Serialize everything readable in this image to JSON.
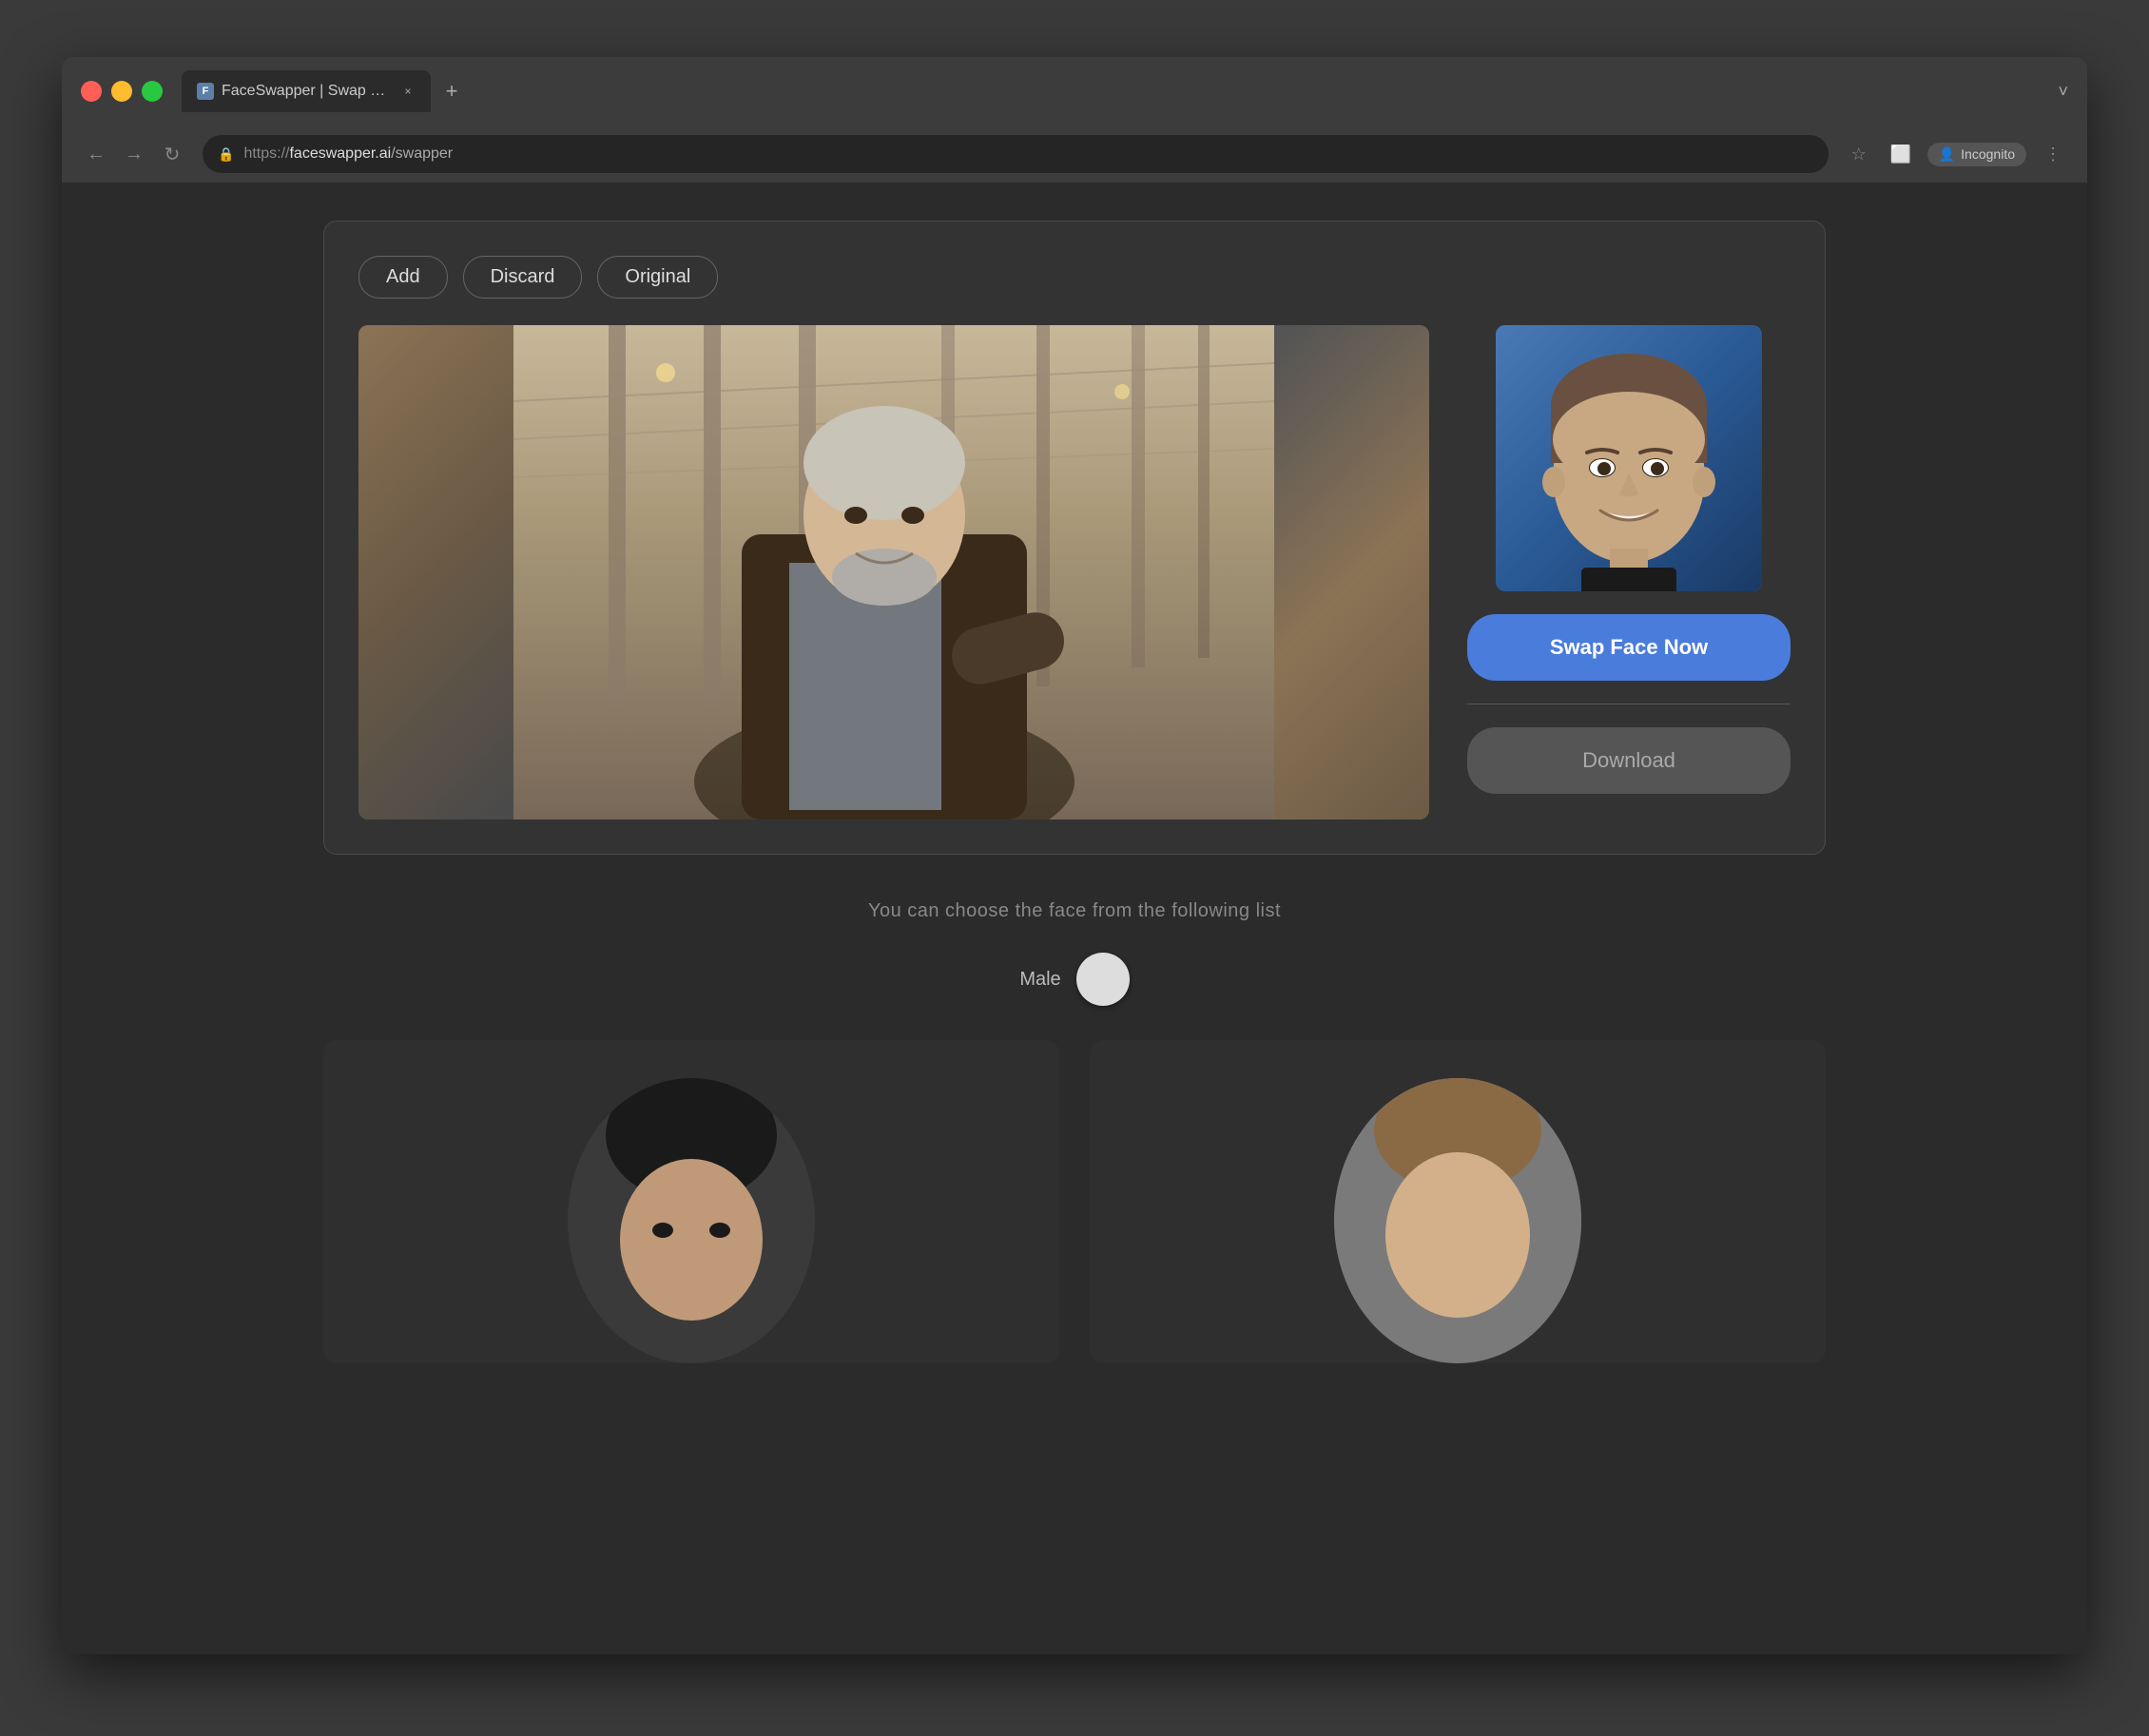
{
  "browser": {
    "traffic_lights": [
      "red",
      "yellow",
      "green"
    ],
    "tab": {
      "favicon_label": "F",
      "title": "FaceSwapper | Swap photo vid",
      "close_icon": "×"
    },
    "tab_new_icon": "+",
    "tab_more_icon": "˅",
    "nav": {
      "back_icon": "←",
      "forward_icon": "→",
      "reload_icon": "↻"
    },
    "url": {
      "protocol": "https://",
      "domain": "faceswapper.ai",
      "path": "/swapper"
    },
    "toolbar": {
      "bookmark_icon": "☆",
      "tab_icon": "⬜",
      "incognito_icon": "👤",
      "incognito_label": "Incognito",
      "menu_icon": "⋮"
    }
  },
  "main_card": {
    "toolbar_buttons": [
      "Add",
      "Discard",
      "Original"
    ],
    "swap_button_label": "Swap Face Now",
    "download_button_label": "Download"
  },
  "face_list": {
    "hint_text": "You can choose the face from the following list",
    "gender_label": "Male"
  }
}
